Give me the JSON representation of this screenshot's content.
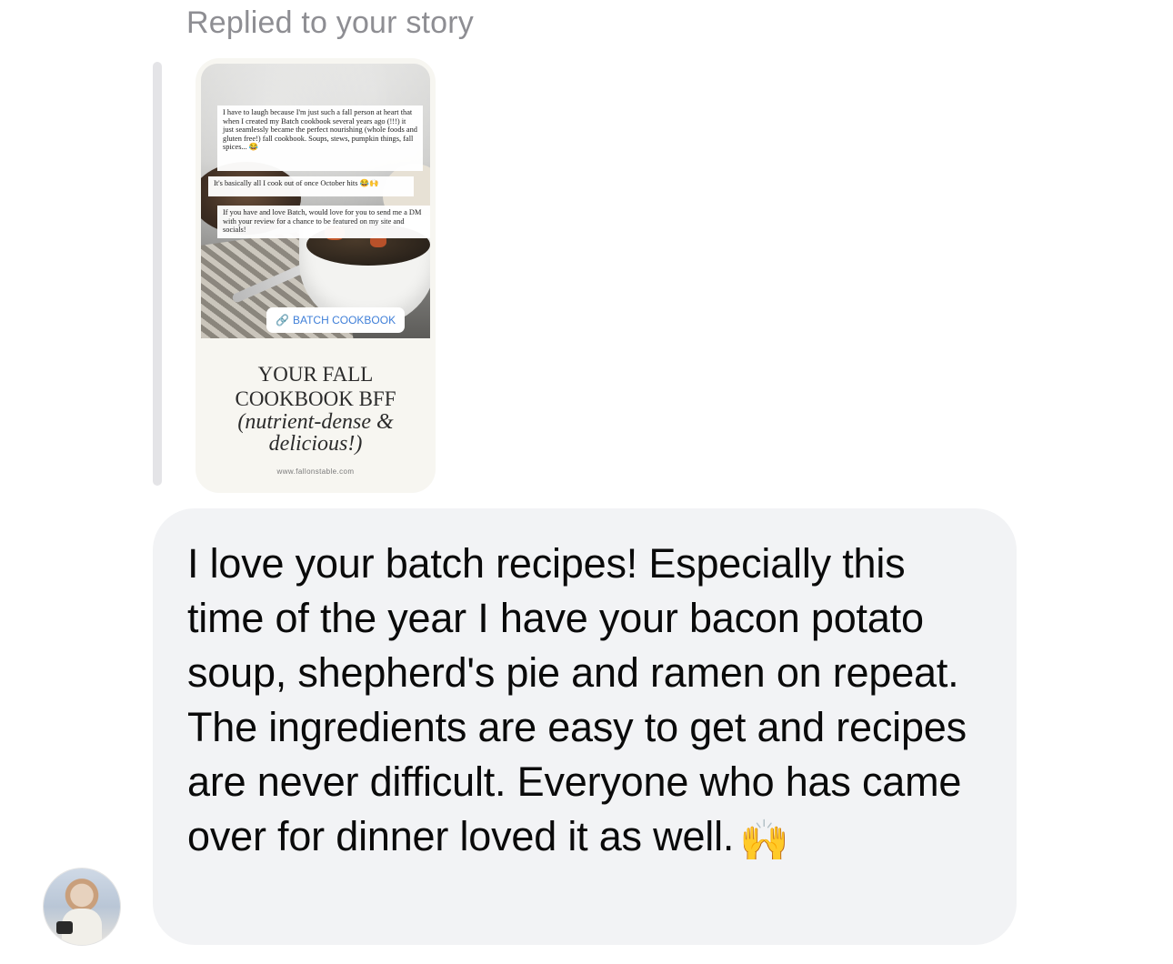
{
  "header": {
    "replied_label": "Replied to your story"
  },
  "story": {
    "text_box_1": "I have to laugh because I'm just such a fall person at heart that when I created my Batch cookbook several years ago (!!!) it just seamlessly became the perfect nourishing (whole foods and gluten free!) fall cookbook. Soups, stews, pumpkin things, fall spices... 😂",
    "text_box_2": "It's basically all I cook out of once October hits 😂🙌",
    "text_box_3": "If you have and love Batch, would love for you to send me a DM with your review for a chance to be featured on my site and socials!",
    "link_sticker_label": "BATCH COOKBOOK",
    "title_line_1": "YOUR FALL",
    "title_line_2": "COOKBOOK BFF",
    "title_line_3": "(nutrient-dense & delicious!)",
    "url": "www.fallonstable.com"
  },
  "message": {
    "text": "I love your batch recipes! Especially this time of the year I have your bacon potato soup, shepherd's pie and ramen on repeat. The ingredients are easy to get and recipes are never difficult. Everyone who has came over for dinner loved it as well.",
    "emoji": "🙌",
    "bubble_color": "#f2f3f5"
  },
  "sender": {
    "avatar_icon": "user-avatar"
  },
  "colors": {
    "meta_text": "#8e8e93",
    "link_blue": "#3f7fd8",
    "reply_bar": "#e4e4e7"
  }
}
